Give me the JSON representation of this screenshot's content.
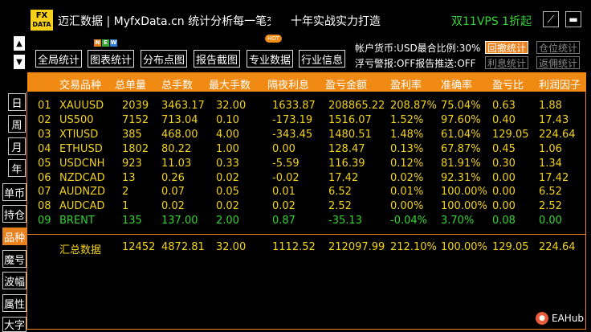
{
  "header": {
    "logo_top": "FX",
    "logo_bottom": "DATA",
    "title": "迈汇数据 | MyfxData.cn  统计分析每一笔交易",
    "slogan": "十年实战实力打造",
    "promo": "双11VPS 1折起",
    "promo_color": "#35d435"
  },
  "icons": {
    "up": "▲",
    "down": "▼",
    "minimize": "⟋",
    "menu": "▬"
  },
  "toolbar": {
    "buttons": [
      "全局统计",
      "图表统计",
      "分布点图",
      "报告截图",
      "专业数据",
      "行业信息"
    ],
    "new_badge": [
      "N",
      "E",
      "W"
    ],
    "hot_badge": "HOT"
  },
  "account": {
    "line1": "帐户货币:USD最合比例:30%",
    "line2": "浮亏警报:OFF报告推送:OFF",
    "buttons_row1": [
      "回撤统计",
      "仓位统计"
    ],
    "buttons_row2": [
      "利息统计",
      "返佣统计"
    ]
  },
  "side_tabs": [
    "日",
    "周",
    "月",
    "年",
    "单币",
    "持仓",
    "品种",
    "魔号",
    "波幅",
    "属性",
    "大字"
  ],
  "side_active": "品种",
  "table": {
    "columns": [
      "交易品种",
      "总单量",
      "总手数",
      "最大手数",
      "隔夜利息",
      "盈亏金额",
      "盈利率",
      "准确率",
      "盈亏比",
      "利润因子"
    ],
    "rows": [
      [
        "01",
        "XAUUSD",
        "2039",
        "3463.17",
        "32.00",
        "1633.87",
        "208865.22",
        "208.87%",
        "75.04%",
        "0.63",
        "1.88"
      ],
      [
        "02",
        "US500",
        "7152",
        "713.04",
        "0.10",
        "-173.19",
        "1516.07",
        "1.52%",
        "97.60%",
        "0.40",
        "17.43"
      ],
      [
        "03",
        "XTIUSD",
        "385",
        "468.00",
        "4.00",
        "-343.45",
        "1480.51",
        "1.48%",
        "61.04%",
        "129.05",
        "224.64"
      ],
      [
        "04",
        "ETHUSD",
        "1802",
        "80.22",
        "1.00",
        "0.00",
        "128.47",
        "0.13%",
        "67.87%",
        "0.45",
        "1.06"
      ],
      [
        "05",
        "USDCNH",
        "923",
        "11.03",
        "0.33",
        "-5.59",
        "116.39",
        "0.12%",
        "81.91%",
        "0.30",
        "1.34"
      ],
      [
        "06",
        "NZDCAD",
        "13",
        "0.26",
        "0.02",
        "-0.02",
        "17.42",
        "0.02%",
        "92.31%",
        "0.00",
        "17.42"
      ],
      [
        "07",
        "AUDNZD",
        "2",
        "0.07",
        "0.05",
        "0.01",
        "6.52",
        "0.01%",
        "100.00%",
        "0.00",
        "6.52"
      ],
      [
        "08",
        "AUDCAD",
        "1",
        "0.02",
        "0.02",
        "0.02",
        "2.52",
        "0.00%",
        "100.00%",
        "0.00",
        "2.52"
      ],
      [
        "09",
        "BRENT",
        "135",
        "137.00",
        "2.00",
        "0.87",
        "-35.13",
        "-0.04%",
        "3.70%",
        "0.08",
        "0.00"
      ]
    ],
    "row_colors": [
      "#f2d21c",
      "#f2d21c",
      "#f2d21c",
      "#f2d21c",
      "#f2d21c",
      "#f2d21c",
      "#f2d21c",
      "#f2d21c",
      "#35d435"
    ],
    "summary": [
      "汇总数据",
      "12452",
      "4872.81",
      "32.00",
      "1112.52",
      "212097.99",
      "212.10%",
      "100.00%",
      "129.05",
      "224.64"
    ]
  },
  "colors": {
    "accent": "#f08a12",
    "yellow": "#f2d21c",
    "green": "#35d435"
  },
  "watermark": "EAHub"
}
